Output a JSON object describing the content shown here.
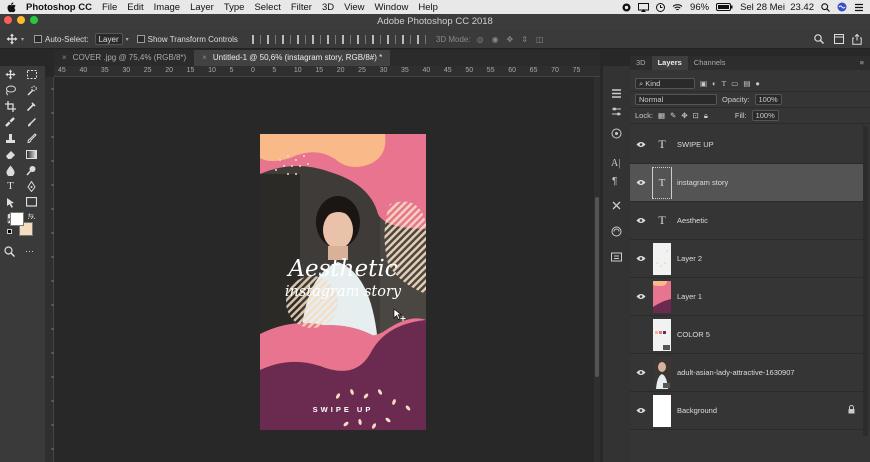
{
  "menubar": {
    "app_name": "Photoshop CC",
    "items": [
      "File",
      "Edit",
      "Image",
      "Layer",
      "Type",
      "Select",
      "Filter",
      "3D",
      "View",
      "Window",
      "Help"
    ],
    "battery": "96%",
    "datetime": "Sel 28 Mei  23.42"
  },
  "window": {
    "title": "Adobe Photoshop CC 2018"
  },
  "options": {
    "auto_select_label": "Auto-Select:",
    "auto_select_value": "Layer",
    "transform_label": "Show Transform Controls",
    "mode3d_label": "3D Mode:"
  },
  "tabs": [
    {
      "label": "COVER .jpg @ 75,4% (RGB/8*)"
    },
    {
      "label": "Untitled-1 @ 50,6% (instagram story, RGB/8#) *"
    }
  ],
  "ruler": {
    "ticks": [
      "45",
      "40",
      "35",
      "30",
      "25",
      "20",
      "15",
      "10",
      "5",
      "0",
      "5",
      "10",
      "15",
      "20",
      "25",
      "30",
      "35",
      "40",
      "45",
      "50",
      "55",
      "60",
      "65",
      "70",
      "75"
    ]
  },
  "artboard": {
    "title_line1": "Aesthetic",
    "title_line2": "instagram story",
    "swipe": "SWIPE UP",
    "colors": {
      "pink": "#e8748f",
      "peach": "#f9b988",
      "plum": "#6b2a4f",
      "cream": "#f5dcc0"
    }
  },
  "layers_panel": {
    "tabs": [
      "3D",
      "Layers",
      "Channels"
    ],
    "filter_label": "Kind",
    "blend_mode": "Normal",
    "opacity_label": "Opacity:",
    "opacity_value": "100%",
    "lock_label": "Lock:",
    "fill_label": "Fill:",
    "fill_value": "100%",
    "layers": [
      {
        "name": "SWIPE UP",
        "kind": "text",
        "visible": true
      },
      {
        "name": "instagram story",
        "kind": "text",
        "visible": true,
        "selected": true
      },
      {
        "name": "Aesthetic",
        "kind": "text",
        "visible": true
      },
      {
        "name": "Layer 2",
        "kind": "pixel",
        "visible": true
      },
      {
        "name": "Layer 1",
        "kind": "pixel",
        "visible": true
      },
      {
        "name": "COLOR 5",
        "kind": "smart",
        "visible": false
      },
      {
        "name": "adult-asian-lady-attractive-1630907",
        "kind": "smart",
        "visible": true
      },
      {
        "name": "Background",
        "kind": "background",
        "visible": true,
        "locked": true
      }
    ]
  }
}
